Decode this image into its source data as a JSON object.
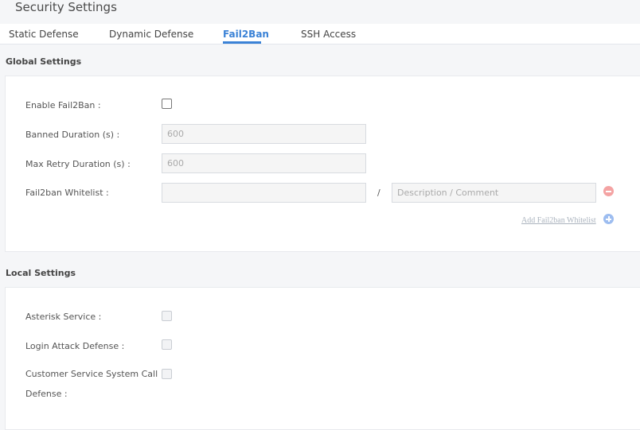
{
  "page": {
    "title": "Security Settings"
  },
  "tabs": [
    {
      "label": "Static Defense",
      "active": false
    },
    {
      "label": "Dynamic Defense",
      "active": false
    },
    {
      "label": "Fail2Ban",
      "active": true
    },
    {
      "label": "SSH Access",
      "active": false
    }
  ],
  "global": {
    "title": "Global Settings",
    "enable_label": "Enable Fail2Ban :",
    "enable_checked": false,
    "banned_label": "Banned Duration (s) :",
    "banned_value": "600",
    "retry_label": "Max Retry Duration (s) :",
    "retry_value": "600",
    "whitelist_label": "Fail2ban Whitelist :",
    "whitelist_value": "",
    "separator": "/",
    "description_placeholder": "Description / Comment",
    "add_whitelist_label": "Add Fail2ban Whitelist"
  },
  "local": {
    "title": "Local Settings",
    "asterisk_label": "Asterisk Service :",
    "login_label": "Login Attack Defense :",
    "customer_label": "Customer Service System Call Defense :"
  },
  "colors": {
    "accent": "#3b82d6",
    "remove_icon": "#f4a3a3",
    "add_icon": "#9dbdf0"
  },
  "icons": {
    "remove": "minus-circle-icon",
    "add": "plus-circle-icon"
  }
}
